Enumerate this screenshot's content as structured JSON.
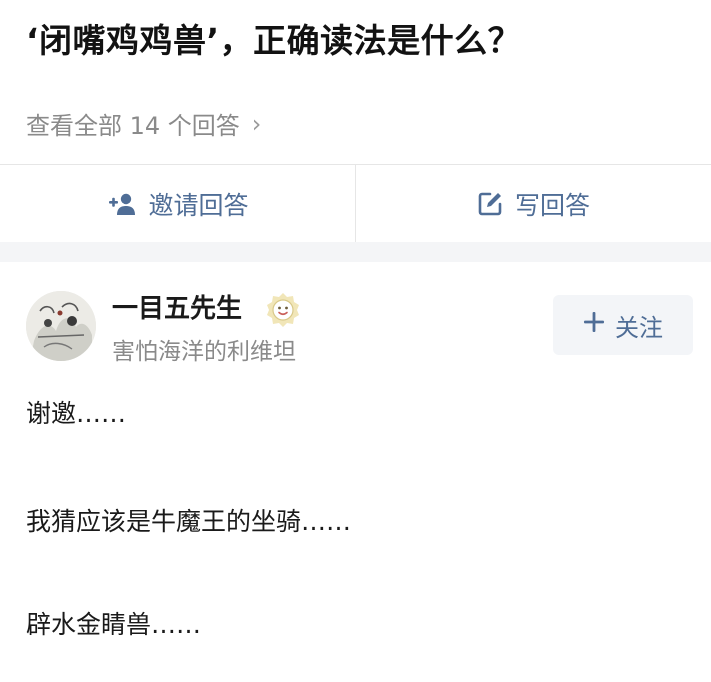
{
  "question": {
    "title": "‘闭嘴鸡鸡兽’，正确读法是什么？",
    "view_all": "查看全部 14 个回答",
    "chevron": "›"
  },
  "actions": {
    "invite": {
      "label": "邀请回答",
      "icon": "add-person-icon"
    },
    "write": {
      "label": "写回答",
      "icon": "edit-icon"
    }
  },
  "answer": {
    "author": {
      "name": "一目五先生",
      "bio": "害怕海洋的利维坦",
      "badge_icon": "smiley-badge-icon"
    },
    "follow": {
      "label": "关注",
      "icon": "plus-icon"
    },
    "lines": [
      "谢邀……",
      "我猜应该是牛魔王的坐骑……",
      "辟水金睛兽……"
    ]
  },
  "colors": {
    "accent": "#4f6d96",
    "muted_text": "#8a8a8a",
    "divider": "#e6e6e6",
    "band": "#f4f5f7"
  }
}
